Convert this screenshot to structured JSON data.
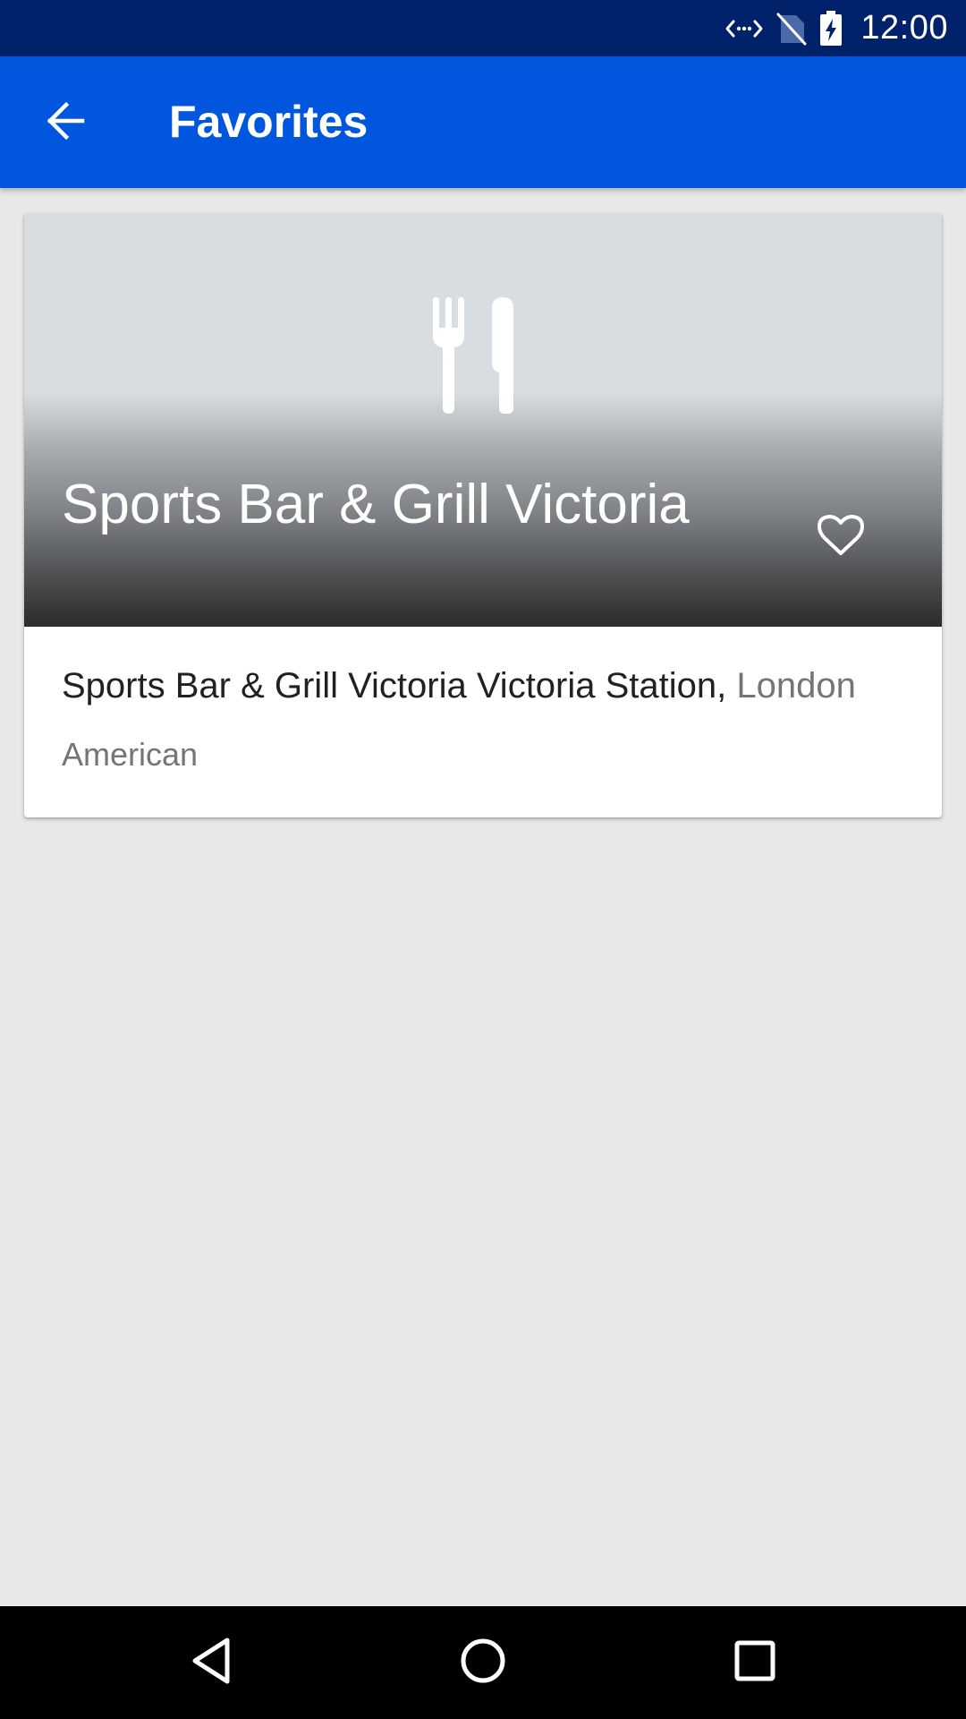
{
  "status_bar": {
    "time": "12:00",
    "icons": [
      "data-sync-icon",
      "no-sim-icon",
      "battery-charging-icon"
    ]
  },
  "app_bar": {
    "title": "Favorites",
    "back_icon": "arrow-back-icon",
    "color": "#0057dd"
  },
  "card": {
    "title": "Sports Bar & Grill Victoria",
    "address": "Sports Bar & Grill Victoria Victoria Station,",
    "city": "London",
    "cuisine": "American",
    "hero_icon": "cutlery-icon",
    "favorite_icon": "heart-outline-icon",
    "favorite": true
  },
  "nav_bar": {
    "icons": [
      "back-triangle-icon",
      "home-circle-icon",
      "recents-square-icon"
    ]
  }
}
